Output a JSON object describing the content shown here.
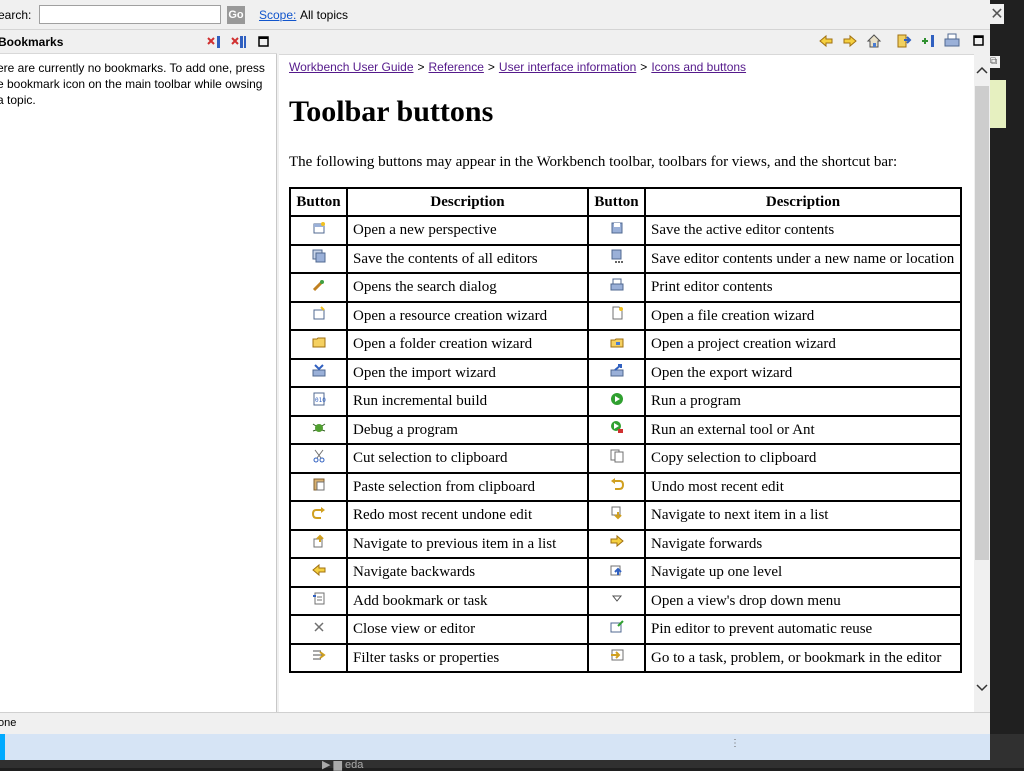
{
  "search": {
    "label": "earch:",
    "value": "",
    "go_label": "Go",
    "scope_link": "Scope:",
    "scope_value": "All topics"
  },
  "bookmarks": {
    "title": "Bookmarks",
    "message": "ere are currently no bookmarks. To add one, press e bookmark icon on the main toolbar while owsing a topic."
  },
  "breadcrumb": [
    "Workbench User Guide",
    "Reference",
    "User interface information",
    "Icons and buttons"
  ],
  "breadcrumb_sep": ">",
  "page": {
    "title": "Toolbar buttons",
    "intro": "The following buttons may appear in the Workbench toolbar, toolbars for views, and the shortcut bar:"
  },
  "table": {
    "headers": [
      "Button",
      "Description",
      "Button",
      "Description"
    ],
    "rows": [
      {
        "icon1": "new-perspective-icon",
        "desc1": "Open a new perspective",
        "icon2": "save-icon",
        "desc2": "Save the active editor contents"
      },
      {
        "icon1": "save-all-icon",
        "desc1": "Save the contents of all editors",
        "icon2": "save-as-icon",
        "desc2": "Save editor contents under a new name or location"
      },
      {
        "icon1": "search-icon",
        "desc1": "Opens the search dialog",
        "icon2": "print-icon",
        "desc2": "Print editor contents"
      },
      {
        "icon1": "new-resource-icon",
        "desc1": "Open a resource creation wizard",
        "icon2": "new-file-icon",
        "desc2": "Open a file creation wizard"
      },
      {
        "icon1": "new-folder-icon",
        "desc1": "Open a folder creation wizard",
        "icon2": "new-project-icon",
        "desc2": "Open a project creation wizard"
      },
      {
        "icon1": "import-icon",
        "desc1": "Open the import wizard",
        "icon2": "export-icon",
        "desc2": "Open the export wizard"
      },
      {
        "icon1": "build-icon",
        "desc1": "Run incremental build",
        "icon2": "run-icon",
        "desc2": "Run a program"
      },
      {
        "icon1": "debug-icon",
        "desc1": "Debug a program",
        "icon2": "external-tool-icon",
        "desc2": "Run an external tool or Ant"
      },
      {
        "icon1": "cut-icon",
        "desc1": "Cut selection to clipboard",
        "icon2": "copy-icon",
        "desc2": "Copy selection to clipboard"
      },
      {
        "icon1": "paste-icon",
        "desc1": "Paste selection from clipboard",
        "icon2": "undo-icon",
        "desc2": "Undo most recent edit"
      },
      {
        "icon1": "redo-icon",
        "desc1": "Redo most recent undone edit",
        "icon2": "next-item-icon",
        "desc2": "Navigate to next item in a list"
      },
      {
        "icon1": "previous-item-icon",
        "desc1": "Navigate to previous item in a list",
        "icon2": "forward-icon",
        "desc2": "Navigate forwards"
      },
      {
        "icon1": "back-icon",
        "desc1": "Navigate backwards",
        "icon2": "up-level-icon",
        "desc2": "Navigate up one level"
      },
      {
        "icon1": "add-bookmark-icon",
        "desc1": "Add bookmark or task",
        "icon2": "view-menu-icon",
        "desc2": "Open a view's drop down menu"
      },
      {
        "icon1": "close-view-icon",
        "desc1": "Close view or editor",
        "icon2": "pin-editor-icon",
        "desc2": "Pin editor to prevent automatic reuse"
      },
      {
        "icon1": "filter-icon",
        "desc1": "Filter tasks or properties",
        "icon2": "goto-task-icon",
        "desc2": "Go to a task, problem, or bookmark in the editor"
      }
    ]
  },
  "status": {
    "text": "one"
  },
  "taskbar": {
    "folder_label": "eda"
  },
  "colors": {
    "link": "#1155cc",
    "visited_link": "#551a8b",
    "scroll_thumb": "#cdcdcd",
    "taskbar_light": "#d6e4f5"
  }
}
